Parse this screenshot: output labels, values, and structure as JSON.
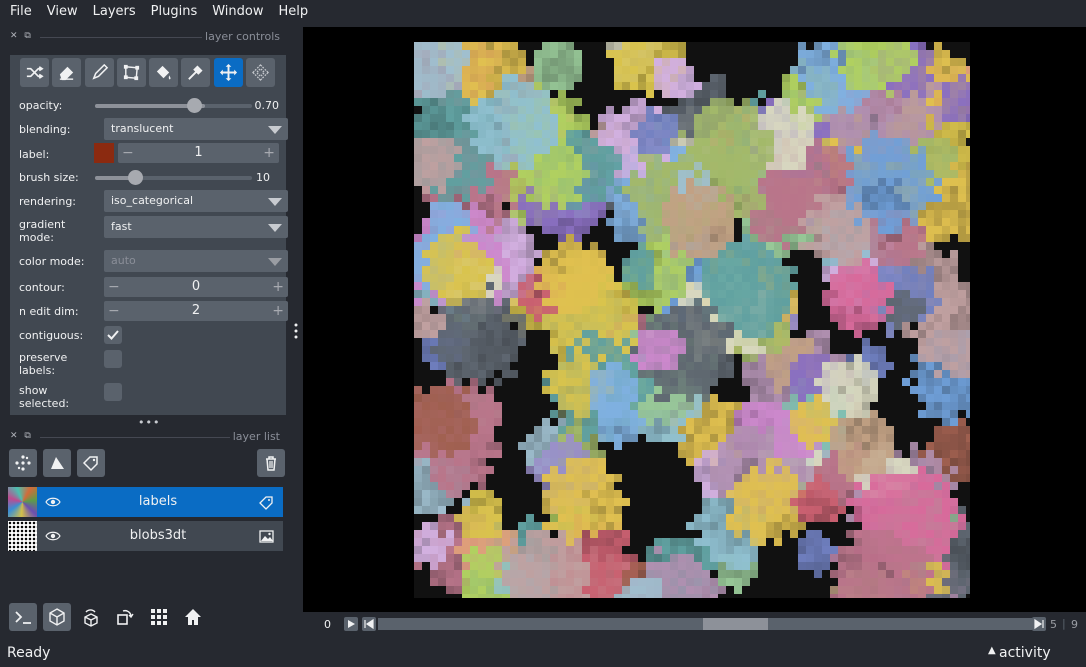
{
  "menu": [
    "File",
    "View",
    "Layers",
    "Plugins",
    "Window",
    "Help"
  ],
  "layer_controls": {
    "title": "layer controls",
    "tools": [
      "shuffle-icon",
      "eraser-icon",
      "paint-brush-icon",
      "transform-icon",
      "fill-bucket-icon",
      "color-picker-icon",
      "pan-zoom-icon",
      "transform-select-icon"
    ],
    "active_tool": "pan-zoom-icon",
    "opacity": {
      "label": "opacity:",
      "value": "0.70",
      "fraction": 0.7
    },
    "blending": {
      "label": "blending:",
      "value": "translucent"
    },
    "label": {
      "label": "label:",
      "value": "1",
      "color": "#8b2a10"
    },
    "brush_size": {
      "label": "brush size:",
      "value": "10",
      "fraction": 0.25
    },
    "rendering": {
      "label": "rendering:",
      "value": "iso_categorical"
    },
    "gradient_mode": {
      "label1": "gradient",
      "label2": "mode:",
      "value": "fast"
    },
    "color_mode": {
      "label": "color mode:",
      "value": "auto"
    },
    "contour": {
      "label": "contour:",
      "value": "0"
    },
    "n_edit_dim": {
      "label": "n edit dim:",
      "value": "2"
    },
    "contiguous": {
      "label": "contiguous:",
      "checked": true
    },
    "preserve_labels": {
      "label1": "preserve",
      "label2": "labels:",
      "checked": false
    },
    "show_selected": {
      "label1": "show",
      "label2": "selected:",
      "checked": false
    }
  },
  "layer_list": {
    "title": "layer list",
    "layers": [
      {
        "name": "labels",
        "type_icon": "tag-icon",
        "selected": true
      },
      {
        "name": "blobs3dt",
        "type_icon": "image-icon",
        "selected": false
      }
    ]
  },
  "dims": {
    "current": "0",
    "end_a": "5",
    "end_b": "9"
  },
  "status": {
    "text": "Ready",
    "activity": "activity"
  },
  "colors": {
    "accent": "#0a6cc4",
    "panel": "#414851",
    "bg": "#262930"
  }
}
